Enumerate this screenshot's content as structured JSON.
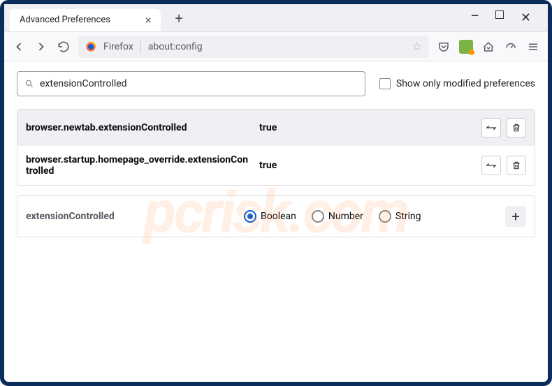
{
  "titlebar": {
    "tab_title": "Advanced Preferences"
  },
  "urlbar": {
    "brand_label": "Firefox",
    "url": "about:config"
  },
  "search": {
    "value": "extensionControlled",
    "checkbox_label": "Show only modified preferences"
  },
  "prefs": [
    {
      "name": "browser.newtab.extensionControlled",
      "value": "true"
    },
    {
      "name": "browser.startup.homepage_override.extensionControlled",
      "value": "true"
    }
  ],
  "new_pref": {
    "name": "extensionControlled",
    "types": [
      "Boolean",
      "Number",
      "String"
    ],
    "selected": "Boolean"
  },
  "watermark": "pcrisk.com"
}
